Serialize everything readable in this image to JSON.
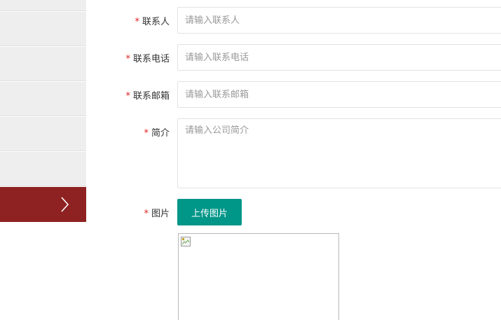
{
  "sidebar": {
    "items": [
      {
        "name": "sidebar-item-1"
      },
      {
        "name": "sidebar-item-2"
      },
      {
        "name": "sidebar-item-3"
      },
      {
        "name": "sidebar-item-4"
      },
      {
        "name": "sidebar-item-5"
      },
      {
        "name": "sidebar-item-6"
      }
    ],
    "active_icon": "chevron-right-icon",
    "active_color": "#8e2222",
    "item_color": "#eeeeee"
  },
  "form": {
    "required_mark": "*",
    "contact_person": {
      "label": "联系人",
      "value": "",
      "placeholder": "请输入联系人"
    },
    "contact_phone": {
      "label": "联系电话",
      "value": "",
      "placeholder": "请输入联系电话"
    },
    "contact_email": {
      "label": "联系邮箱",
      "value": "",
      "placeholder": "请输入联系邮箱"
    },
    "intro": {
      "label": "简介",
      "value": "",
      "placeholder": "请输入公司简介"
    },
    "image": {
      "label": "图片",
      "upload_button": "上传图片",
      "preview_icon": "broken-image-icon"
    },
    "colors": {
      "required": "#e02020",
      "upload_button": "#009688"
    }
  }
}
